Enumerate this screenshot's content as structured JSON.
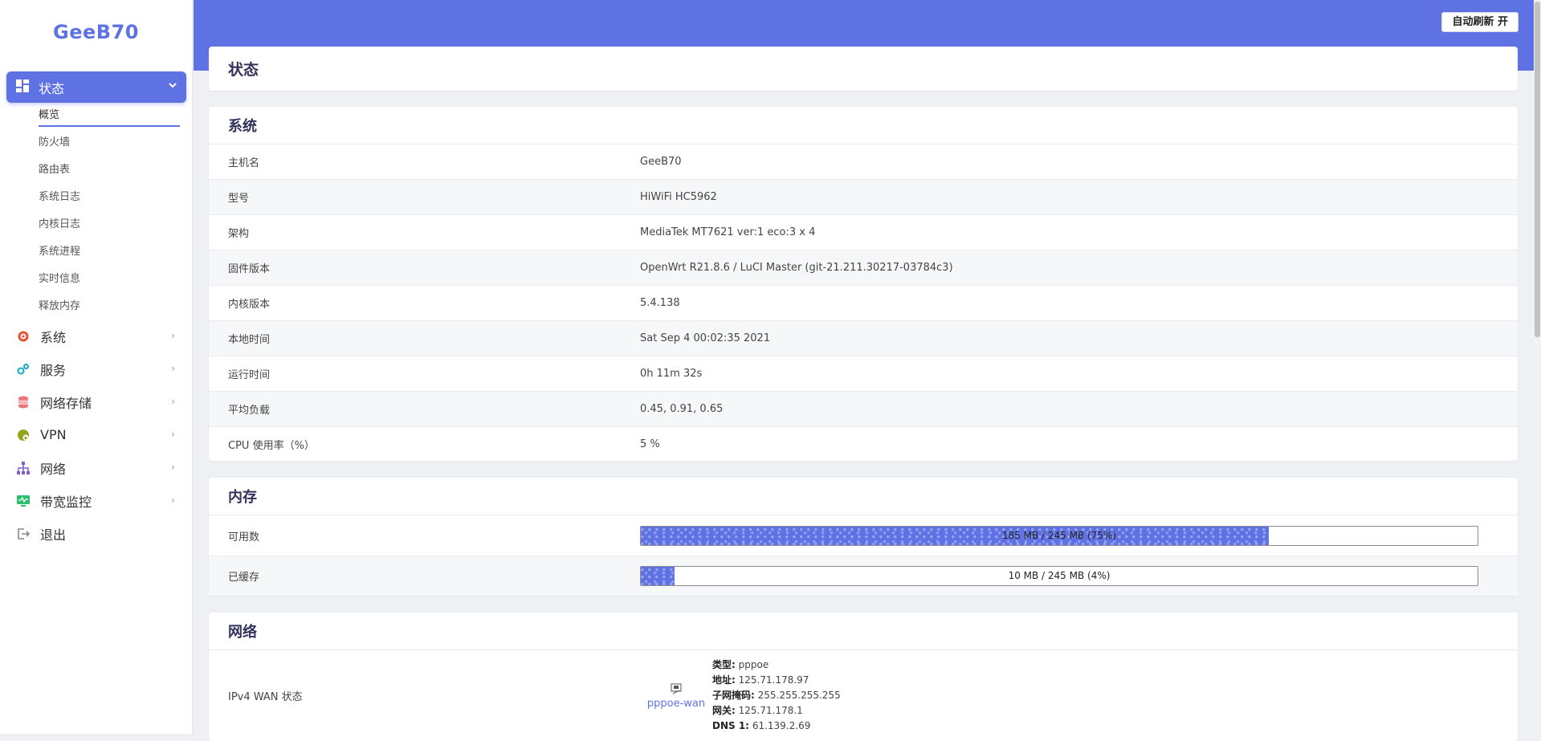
{
  "brand": "GeeB70",
  "header": {
    "auto_refresh": "自动刷新 开"
  },
  "sidebar": {
    "active": {
      "label": "状态"
    },
    "subitems": [
      "概览",
      "防火墙",
      "路由表",
      "系统日志",
      "内核日志",
      "系统进程",
      "实时信息",
      "释放内存"
    ],
    "items": [
      {
        "label": "系统",
        "icon": "gear-icon",
        "color": "#e8502f"
      },
      {
        "label": "服务",
        "icon": "services-icon",
        "color": "#11a8c9"
      },
      {
        "label": "网络存储",
        "icon": "database-icon",
        "color": "#e97575"
      },
      {
        "label": "VPN",
        "icon": "vpn-icon",
        "color": "#9aa31f"
      },
      {
        "label": "网络",
        "icon": "network-icon",
        "color": "#7a5bd4"
      },
      {
        "label": "带宽监控",
        "icon": "monitor-icon",
        "color": "#2bbf6a"
      },
      {
        "label": "退出",
        "icon": "logout-icon",
        "color": "#888888"
      }
    ]
  },
  "page_title": "状态",
  "system": {
    "title": "系统",
    "rows": [
      {
        "k": "主机名",
        "v": "GeeB70"
      },
      {
        "k": "型号",
        "v": "HiWiFi HC5962"
      },
      {
        "k": "架构",
        "v": "MediaTek MT7621 ver:1 eco:3 x 4"
      },
      {
        "k": "固件版本",
        "v": "OpenWrt R21.8.6 / LuCI Master (git-21.211.30217-03784c3)"
      },
      {
        "k": "内核版本",
        "v": "5.4.138"
      },
      {
        "k": "本地时间",
        "v": "Sat Sep 4 00:02:35 2021"
      },
      {
        "k": "运行时间",
        "v": "0h 11m 32s"
      },
      {
        "k": "平均负载",
        "v": "0.45, 0.91, 0.65"
      },
      {
        "k": "CPU 使用率（%）",
        "v": "5 %"
      }
    ]
  },
  "memory": {
    "title": "内存",
    "rows": [
      {
        "k": "可用数",
        "text": "185 MB / 245 MB (75%)",
        "fraction": 0.75
      },
      {
        "k": "已缓存",
        "text": "10 MB / 245 MB (4%)",
        "fraction": 0.04
      }
    ]
  },
  "network": {
    "title": "网络",
    "wan_label": "IPv4 WAN 状态",
    "iface": "pppoe-wan",
    "details": [
      {
        "k": "类型:",
        "v": "pppoe"
      },
      {
        "k": "地址:",
        "v": "125.71.178.97"
      },
      {
        "k": "子网掩码:",
        "v": "255.255.255.255"
      },
      {
        "k": "网关:",
        "v": "125.71.178.1"
      },
      {
        "k": "DNS 1:",
        "v": "61.139.2.69"
      }
    ]
  },
  "colors": {
    "accent": "#5e72e4"
  }
}
